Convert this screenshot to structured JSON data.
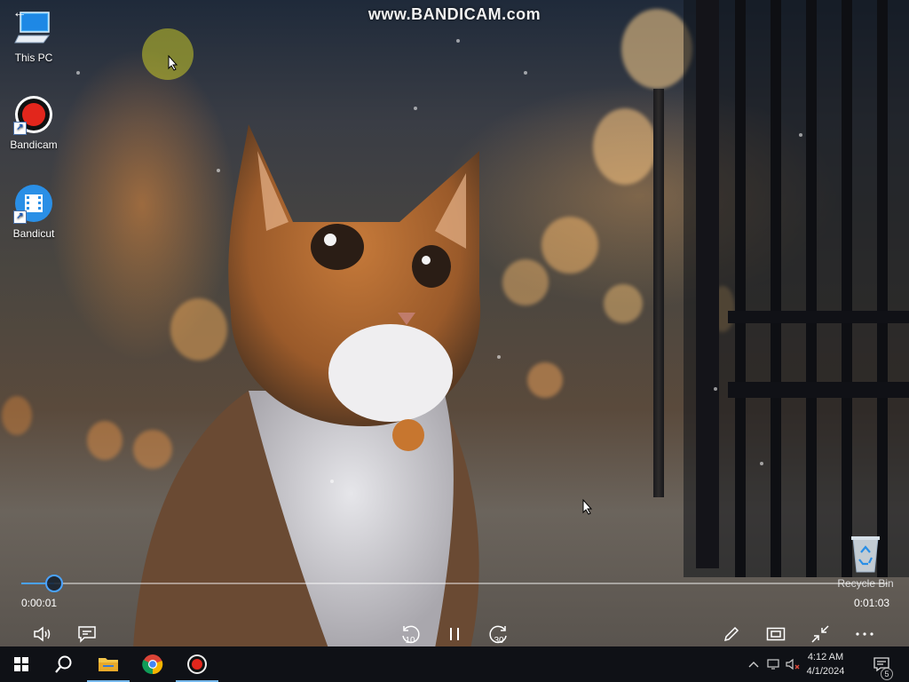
{
  "watermark": "www.BANDICAM.com",
  "desktop": {
    "icons": [
      {
        "label": "This PC",
        "icon": "computer-icon"
      },
      {
        "label": "Bandicam",
        "icon": "bandicam-record-icon"
      },
      {
        "label": "Bandicut",
        "icon": "bandicut-film-icon"
      }
    ],
    "recycle_bin": "Recycle Bin"
  },
  "player": {
    "current_time": "0:00:01",
    "total_time": "0:01:03",
    "progress": 0.038,
    "skip_back_label": "10",
    "skip_forward_label": "30",
    "accent_color": "#4aa3ff"
  },
  "taskbar": {
    "time": "4:12 AM",
    "date": "4/1/2024",
    "notification_count": "5",
    "pinned": [
      "start-icon",
      "search-icon",
      "file-explorer-icon",
      "chrome-icon",
      "bandicam-icon"
    ]
  }
}
